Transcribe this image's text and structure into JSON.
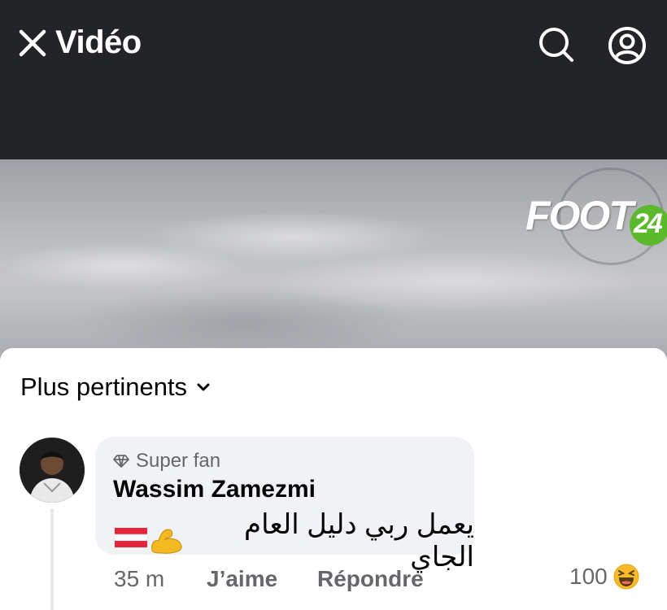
{
  "header": {
    "title": "Vidéo",
    "close_icon": "close-icon",
    "search_icon": "search-icon",
    "profile_icon": "profile-icon",
    "background": "#232427"
  },
  "video": {
    "logo_text": "FOOT",
    "logo_number": "24",
    "logo_accent": "#5cb82c"
  },
  "comments": {
    "sort_label": "Plus pertinents",
    "sort_icon": "chevron-down-icon",
    "items": [
      {
        "badge": "Super fan",
        "badge_icon": "diamond-icon",
        "author": "Wassim Zamezmi",
        "text": "يعمل ربي دليل العام الجاي",
        "emoji": "💪🇦🇹",
        "time": "35 m",
        "like_label": "J’aime",
        "reply_label": "Répondre",
        "reaction_count": "100",
        "reaction_icon": "laughing-emoji-icon"
      }
    ]
  }
}
